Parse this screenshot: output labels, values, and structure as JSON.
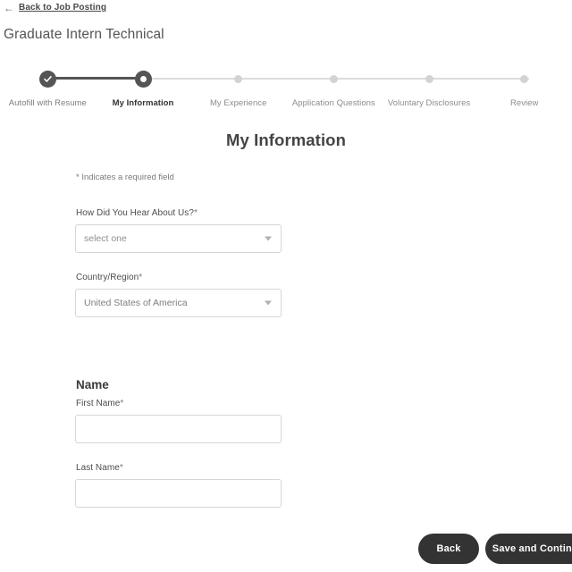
{
  "header": {
    "back_link": "Back to Job Posting",
    "back_arrow_icon": "arrow-left-icon",
    "job_title": "Graduate Intern Technical"
  },
  "stepper": {
    "steps": [
      {
        "label": "Autofill with Resume",
        "state": "done",
        "marker_icon": "check-icon"
      },
      {
        "label": "My Information",
        "state": "current",
        "marker_icon": "current-dot-icon"
      },
      {
        "label": "My Experience",
        "state": "todo",
        "marker_icon": "dot-icon"
      },
      {
        "label": "Application Questions",
        "state": "todo",
        "marker_icon": "dot-icon"
      },
      {
        "label": "Voluntary Disclosures",
        "state": "todo",
        "marker_icon": "dot-icon"
      },
      {
        "label": "Review",
        "state": "todo",
        "marker_icon": "dot-icon"
      }
    ]
  },
  "main": {
    "page_heading": "My Information",
    "required_note": "* Indicates a required field",
    "fields": {
      "source": {
        "label": "How Did You Hear About Us?",
        "required_marker": "*",
        "value": "select one",
        "caret_icon": "chevron-down-icon"
      },
      "country": {
        "label": "Country/Region",
        "required_marker": "*",
        "value": "United States of America",
        "caret_icon": "chevron-down-icon"
      },
      "name_group_heading": "Name",
      "first_name": {
        "label": "First Name",
        "required_marker": "*",
        "value": "",
        "placeholder": ""
      },
      "last_name": {
        "label": "Last Name",
        "required_marker": "*",
        "value": "",
        "placeholder": ""
      }
    }
  },
  "footer": {
    "back_label": "Back",
    "continue_label": "Save and Continue"
  },
  "colors": {
    "accent_dark": "#333333",
    "step_done": "#555555",
    "step_todo": "#d3d3d3",
    "border": "#d6d6d6",
    "text_muted": "#8f8f8f"
  }
}
